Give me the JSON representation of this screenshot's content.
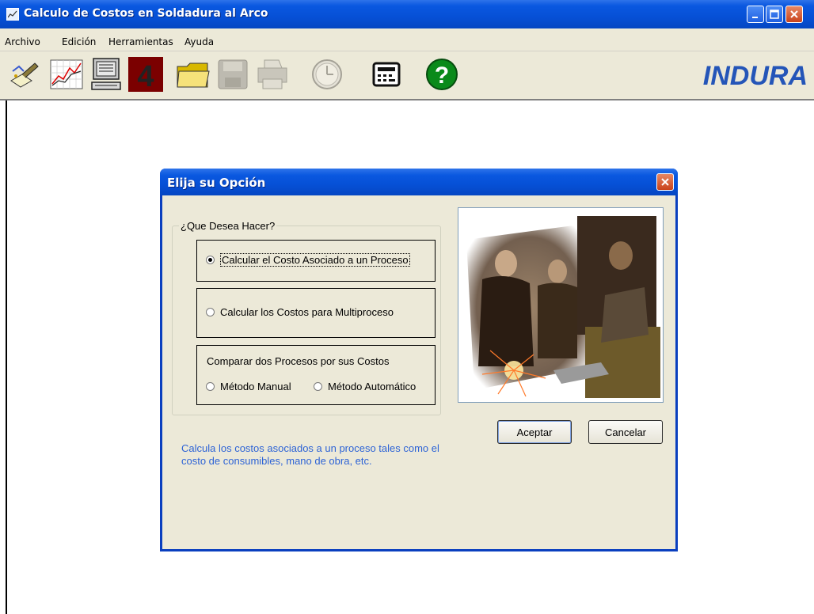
{
  "window": {
    "title": "Calculo de Costos en Soldadura al Arco"
  },
  "menu": [
    {
      "label": "Archivo"
    },
    {
      "label": "Edición"
    },
    {
      "label": "Herramientas"
    },
    {
      "label": "Ayuda"
    }
  ],
  "toolbar": {
    "buttons": [
      {
        "icon": "welding-torch-icon"
      },
      {
        "icon": "line-chart-icon"
      },
      {
        "icon": "computer-icon"
      },
      {
        "icon": "number-four-icon",
        "text": "4"
      },
      {
        "icon": "open-folder-icon"
      },
      {
        "icon": "save-disk-icon",
        "state": "disabled"
      },
      {
        "icon": "printer-icon",
        "state": "disabled"
      },
      {
        "icon": "clock-icon",
        "state": "disabled"
      },
      {
        "icon": "calculator-icon"
      },
      {
        "icon": "help-icon",
        "text": "?"
      }
    ],
    "brand": "INDURA"
  },
  "dialog": {
    "title": "Elija su Opción",
    "group_label": "¿Que Desea Hacer?",
    "options": [
      {
        "label": "Calcular el Costo Asociado a un Proceso",
        "selected": true
      },
      {
        "label": "Calcular los Costos para Multiproceso",
        "selected": false
      }
    ],
    "compare": {
      "label": "Comparar dos Procesos por sus Costos",
      "manual": "Método Manual",
      "auto": "Método Automático"
    },
    "buttons": {
      "ok": "Aceptar",
      "cancel": "Cancelar"
    },
    "description": "Calcula los costos asociados a un proceso tales como el costo de consumibles, mano de obra, etc."
  },
  "colors": {
    "titlebar": "#0a58e0",
    "face": "#ece9d8",
    "hint_text": "#2d63d6",
    "brand": "#2455b8"
  }
}
